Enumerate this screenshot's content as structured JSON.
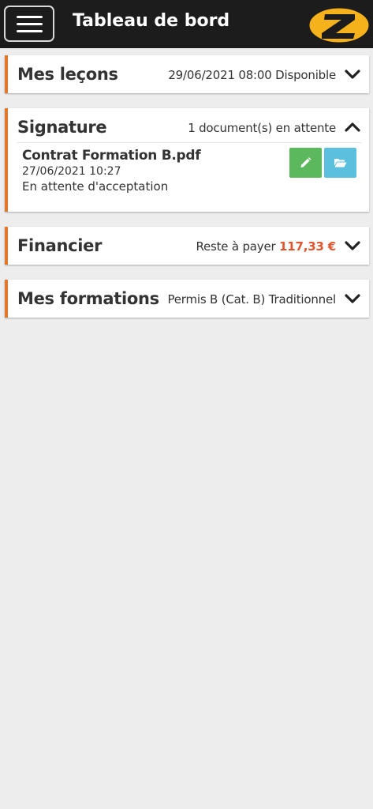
{
  "header": {
    "title": "Tableau de bord",
    "menu_icon": "hamburger-menu-icon",
    "logo_icon": "z-logo-icon",
    "colors": {
      "background": "#1c1c1c",
      "logo_yellow": "#f5b21b"
    }
  },
  "accent_color": "#e0792b",
  "cards": {
    "lecons": {
      "title": "Mes leçons",
      "summary": "29/06/2021 08:00 Disponible",
      "chevron": "chevron-down-icon"
    },
    "signature": {
      "title": "Signature",
      "summary": "1 document(s) en attente",
      "chevron": "chevron-up-icon",
      "documents": [
        {
          "name": "Contrat Formation B.pdf",
          "date": "27/06/2021 10:27",
          "status": "En attente d'acceptation",
          "actions": [
            {
              "icon": "pencil-icon",
              "color": "#5cb85c"
            },
            {
              "icon": "folder-open-icon",
              "color": "#5bc0de"
            }
          ]
        }
      ]
    },
    "financier": {
      "title": "Financier",
      "summary_label": "Reste à payer",
      "amount": "117,33 €",
      "amount_color": "#e0542e",
      "chevron": "chevron-down-icon"
    },
    "formations": {
      "title": "Mes formations",
      "summary": "Permis B (Cat. B) Traditionnel",
      "chevron": "chevron-down-icon"
    }
  }
}
